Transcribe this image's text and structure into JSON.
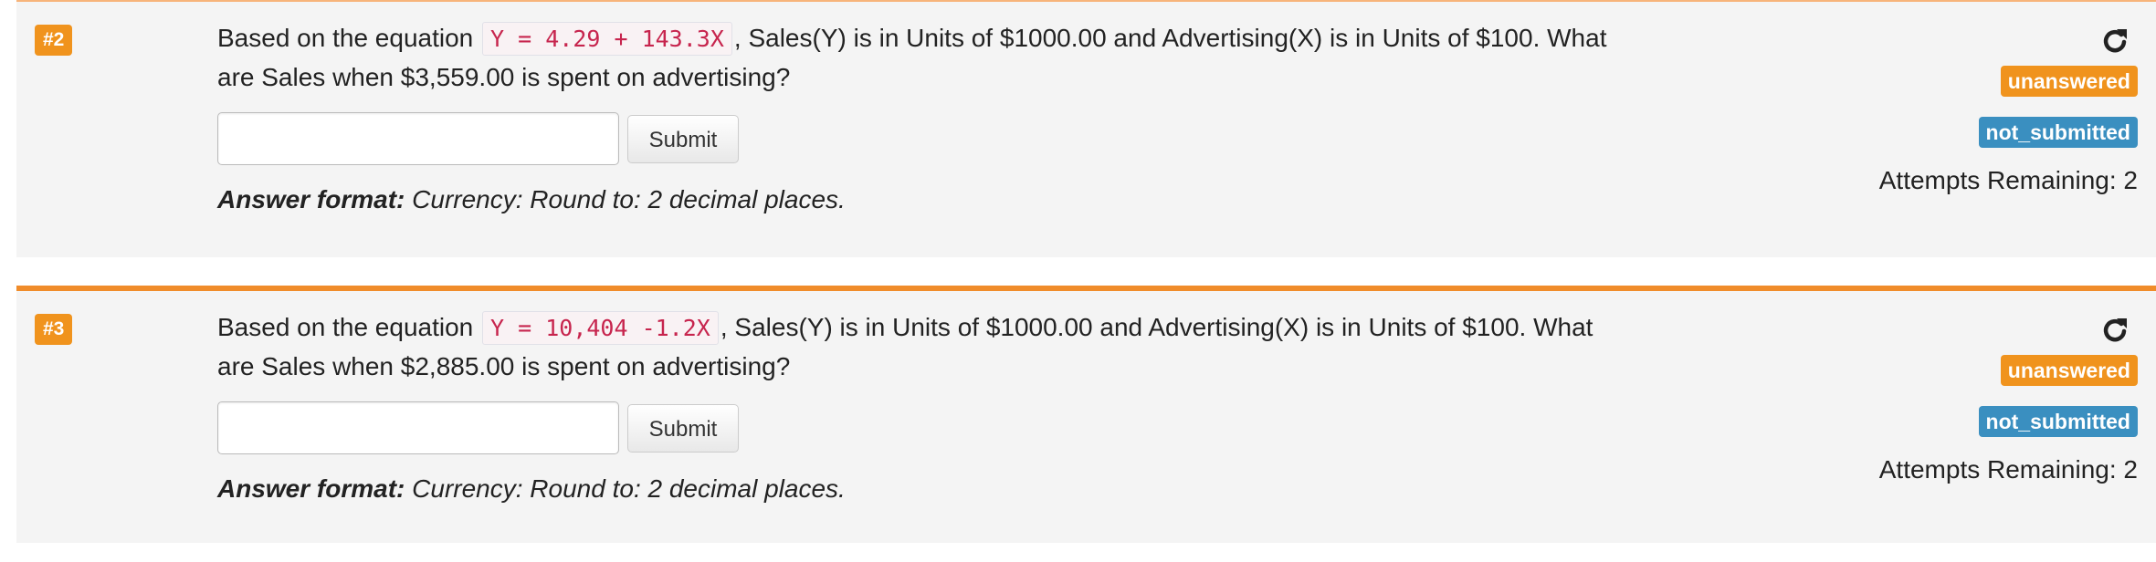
{
  "questions": [
    {
      "number": "#2",
      "text_before": "Based on the equation",
      "equation": "Y = 4.29 + 143.3X",
      "text_after": ", Sales(Y) is in Units of $1000.00 and Advertising(X) is in Units of $100. What are Sales when $3,559.00 is spent on advertising?",
      "answer_value": "",
      "submit_label": "Submit",
      "answer_format_label": "Answer format:",
      "answer_format_text": "Currency: Round to: 2 decimal places.",
      "status_answer": "unanswered",
      "status_submission": "not_submitted",
      "attempts": "Attempts Remaining: 2"
    },
    {
      "number": "#3",
      "text_before": "Based on the equation",
      "equation": "Y = 10,404 -1.2X",
      "text_after": ", Sales(Y) is in Units of $1000.00 and Advertising(X) is in Units of $100. What are Sales when $2,885.00 is spent on advertising?",
      "answer_value": "",
      "submit_label": "Submit",
      "answer_format_label": "Answer format:",
      "answer_format_text": "Currency: Round to: 2 decimal places.",
      "status_answer": "unanswered",
      "status_submission": "not_submitted",
      "attempts": "Attempts Remaining: 2"
    }
  ],
  "icons": {
    "refresh": "refresh-icon"
  },
  "colors": {
    "accent_orange": "#f0931d",
    "badge_blue": "#3a8fc0",
    "equation_red": "#c7254e",
    "panel_bg": "#f4f4f4"
  }
}
